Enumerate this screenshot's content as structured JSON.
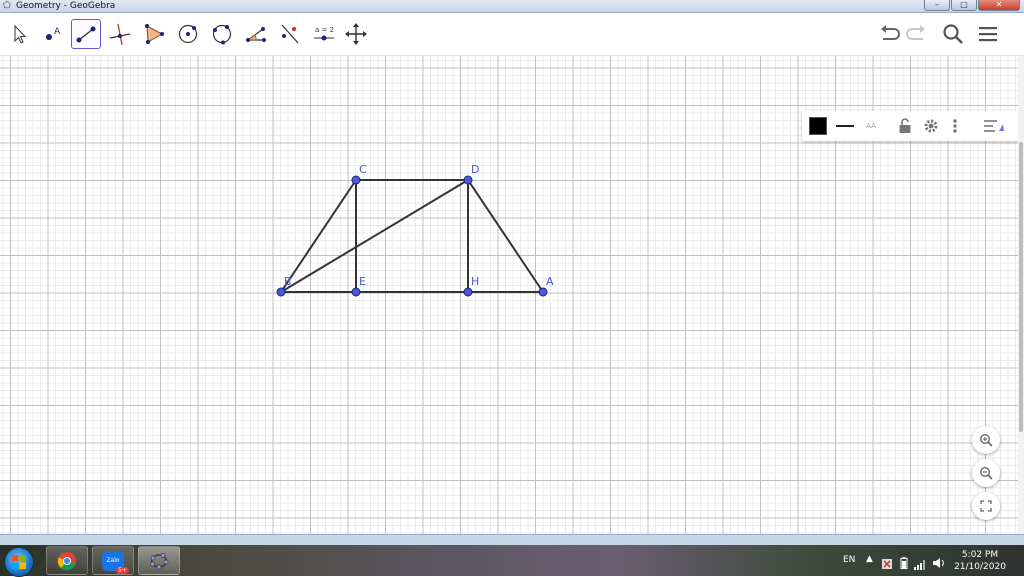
{
  "window": {
    "title": "Geometry - GeoGebra",
    "controls": {
      "minimize": "–",
      "maximize": "□",
      "close": "✕"
    }
  },
  "toolbar": {
    "tools": [
      {
        "name": "move-tool",
        "icon": "arrow-pointer-icon"
      },
      {
        "name": "point-tool",
        "icon": "point-icon"
      },
      {
        "name": "segment-tool",
        "icon": "segment-icon",
        "active": true
      },
      {
        "name": "perpendicular-line-tool",
        "icon": "perpendicular-line-icon"
      },
      {
        "name": "polygon-tool",
        "icon": "polygon-icon"
      },
      {
        "name": "circle-center-point-tool",
        "icon": "circle-center-icon"
      },
      {
        "name": "circle-three-points-tool",
        "icon": "circle-three-points-icon"
      },
      {
        "name": "angle-tool",
        "icon": "angle-icon"
      },
      {
        "name": "reflect-tool",
        "icon": "reflect-icon"
      },
      {
        "name": "slider-tool",
        "icon": "slider-icon",
        "label": "a = 2"
      },
      {
        "name": "move-graphics-view-tool",
        "icon": "move-view-icon"
      }
    ],
    "undo_icon": "undo-icon",
    "redo_icon": "redo-icon",
    "search_icon": "search-icon",
    "menu_icon": "menu-icon"
  },
  "style_bar": {
    "color": "#000000",
    "label_style": "AA"
  },
  "construction": {
    "points": [
      {
        "label": "A",
        "color": "#4a58d9"
      },
      {
        "label": "B",
        "color": "#4a58d9"
      },
      {
        "label": "C",
        "color": "#4a58d9"
      },
      {
        "label": "D",
        "color": "#4a58d9"
      },
      {
        "label": "E",
        "color": "#4a58d9"
      },
      {
        "label": "H",
        "color": "#4a58d9"
      }
    ],
    "segments": [
      "BC",
      "CD",
      "DA",
      "BA",
      "BD",
      "CE",
      "DH"
    ],
    "segment_color": "#333333"
  },
  "zoom_controls": [
    "zoom-in-icon",
    "zoom-out-icon",
    "fullscreen-icon"
  ],
  "taskbar": {
    "apps": [
      "chrome-icon",
      "zalo-icon",
      "geogebra-icon"
    ],
    "zalo_label": "Zalo",
    "zalo_badge": "5+",
    "language": "EN",
    "time": "5:02 PM",
    "date": "21/10/2020"
  }
}
